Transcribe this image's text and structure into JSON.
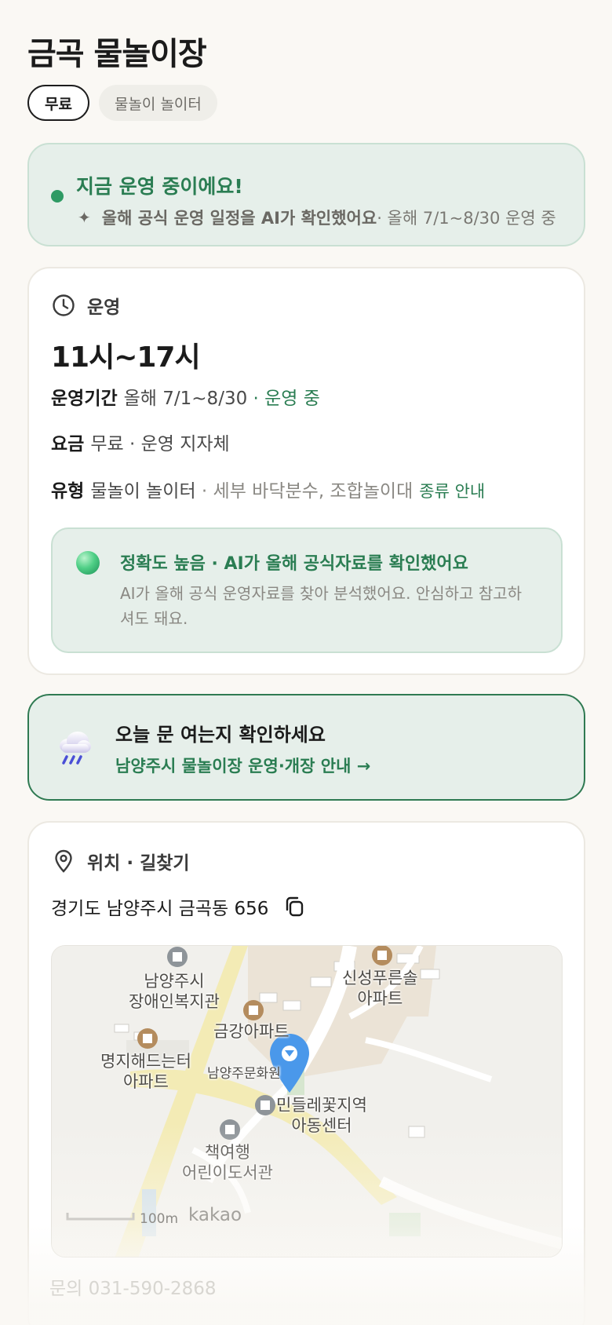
{
  "page": {
    "title": "금곡 물놀이장"
  },
  "chips": [
    {
      "label": "무료"
    },
    {
      "label": "물놀이 놀이터"
    }
  ],
  "status": {
    "headline": "지금 운영 중이에요!",
    "verified": "올해 공식 운영 일정을 AI가 확인했어요",
    "period": " · 올해 7/1~8/30 운영 중",
    "accent_color": "#2a7d52"
  },
  "hours": {
    "section_label": "운영",
    "time": "11시~17시",
    "period_label": "운영기간",
    "period_value": "올해 7/1~8/30",
    "period_status": " · 운영 중",
    "fee_label": "요금",
    "fee_value": "무료 · 운영 지자체",
    "type_label": "유형",
    "type_value": "물놀이 놀이터",
    "type_detail": " · 세부 바닥분수, 조합놀이대",
    "type_link": "종류 안내"
  },
  "accuracy": {
    "headline": "정확도 높음 · AI가 올해 공식자료를 확인했어요",
    "body": "AI가 올해 공식 운영자료를 찾아 분석했어요. 안심하고 참고하셔도 돼요."
  },
  "notice": {
    "headline": "오늘 문 여는지 확인하세요",
    "link": "남양주시 물놀이장 운영·개장 안내 →",
    "icon": "rain-cloud-icon"
  },
  "location": {
    "section_label": "위치 · 길찾기",
    "address": "경기도 남양주시 금곡동 656",
    "map": {
      "labels": [
        "남양주시\n장애인복지관",
        "신성푸른솔\n아파트",
        "금강아파트",
        "명지해드는터\n아파트",
        "남양주문화원",
        "민들레꽃지역\n아동센터",
        "책여행\n어린이도서관"
      ],
      "scale": "100m",
      "brand": "kakao"
    }
  },
  "contact": "문의 031-590-2868"
}
